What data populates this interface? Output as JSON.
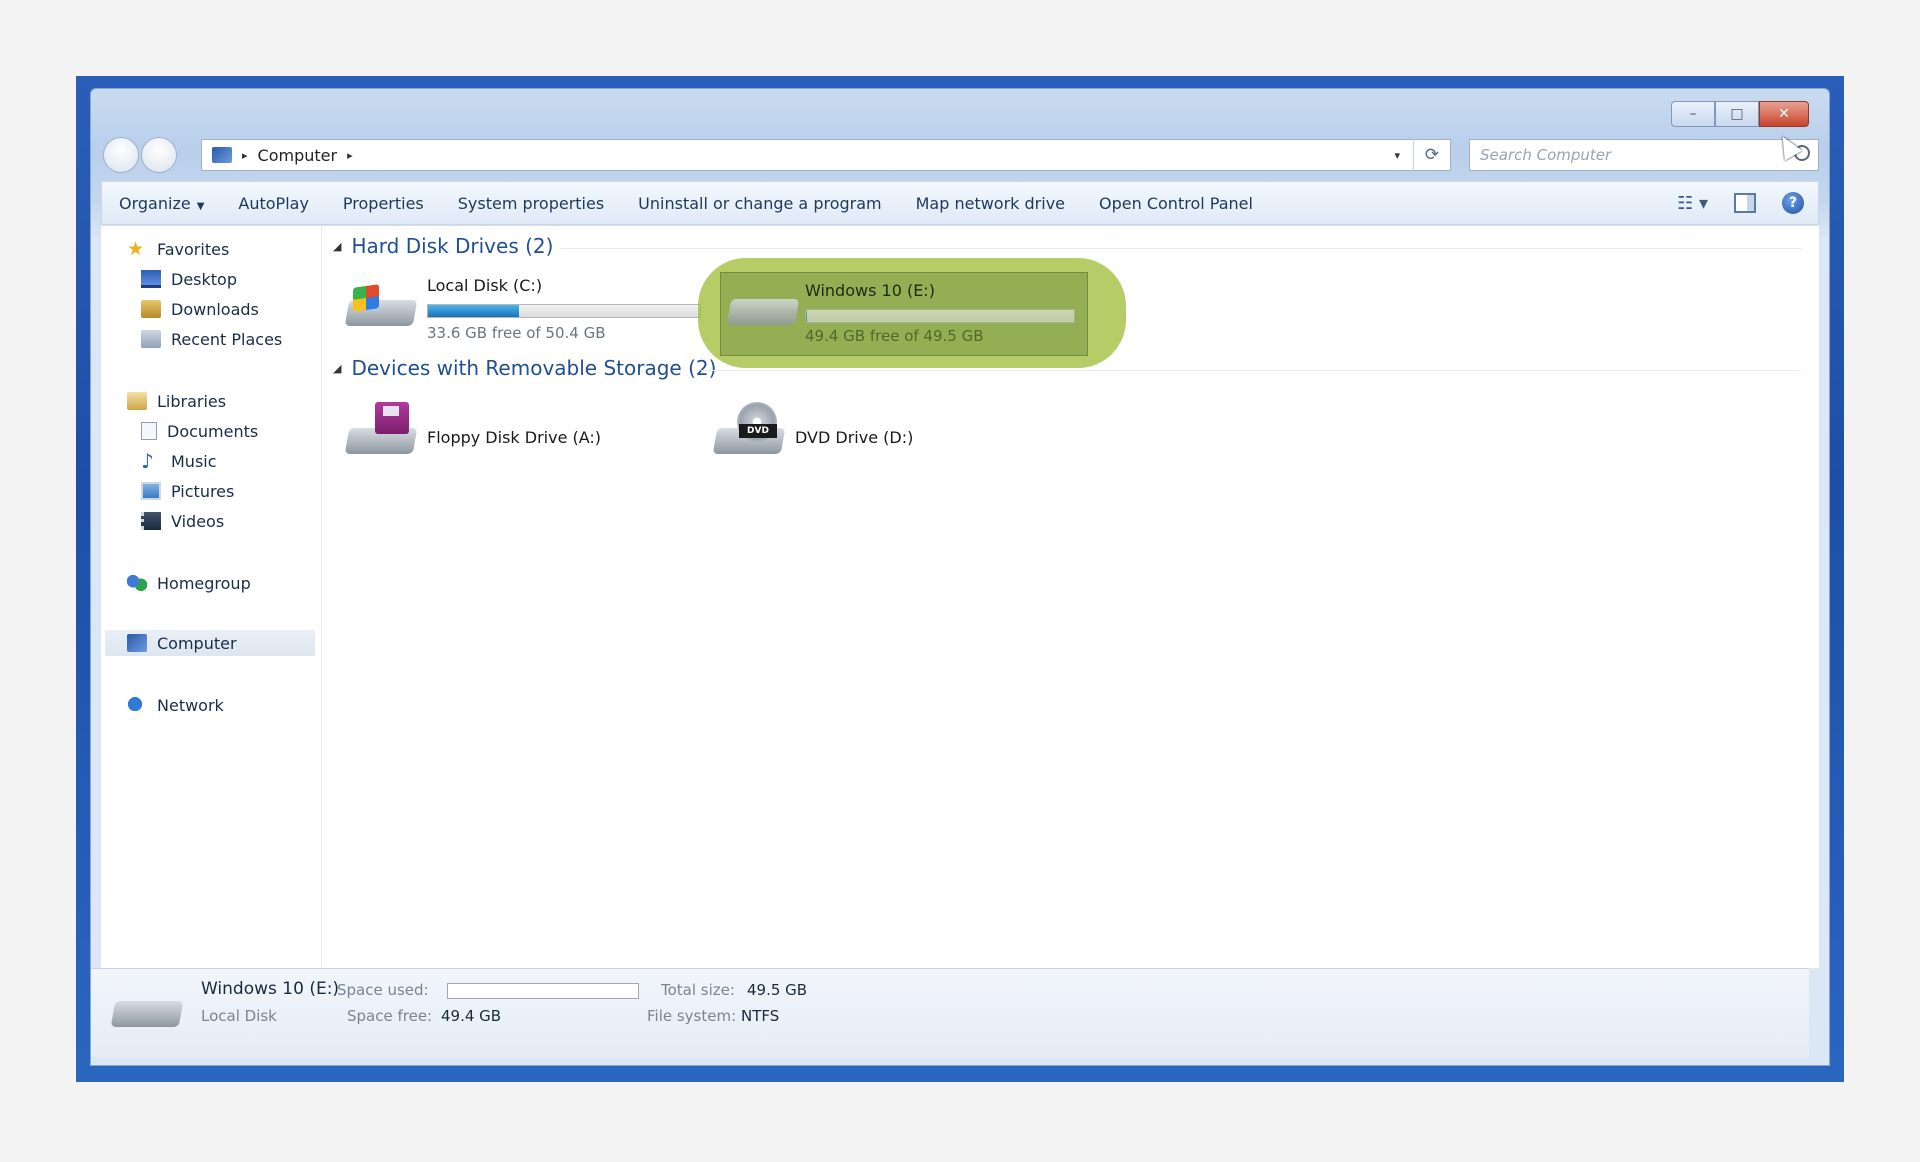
{
  "window": {
    "title_buttons": {
      "minimize": "–",
      "maximize": "□",
      "close": "✕"
    }
  },
  "address_bar": {
    "location": "Computer",
    "separator": "▸",
    "dropdown": "▾",
    "refresh": "⟳"
  },
  "search": {
    "placeholder": "Search Computer"
  },
  "command_bar": {
    "organize": "Organize",
    "autoplay": "AutoPlay",
    "properties": "Properties",
    "system_properties": "System properties",
    "uninstall": "Uninstall or change a program",
    "map_drive": "Map network drive",
    "control_panel": "Open Control Panel",
    "help": "?"
  },
  "sidebar": {
    "favorites": "Favorites",
    "desktop": "Desktop",
    "downloads": "Downloads",
    "recent_places": "Recent Places",
    "libraries": "Libraries",
    "documents": "Documents",
    "music": "Music",
    "pictures": "Pictures",
    "videos": "Videos",
    "homegroup": "Homegroup",
    "computer": "Computer",
    "network": "Network"
  },
  "groups": {
    "hard_disks": "Hard Disk Drives (2)",
    "removable": "Devices with Removable Storage (2)"
  },
  "drives": {
    "c": {
      "name": "Local Disk (C:)",
      "free_text": "33.6 GB free of 50.4 GB",
      "used_fraction": 0.333
    },
    "e": {
      "name": "Windows 10 (E:)",
      "free_text": "49.4 GB free of 49.5 GB",
      "used_fraction": 0.002
    },
    "a": {
      "name": "Floppy Disk Drive (A:)"
    },
    "d": {
      "name": "DVD Drive (D:)",
      "label": "DVD"
    }
  },
  "details": {
    "name": "Windows 10 (E:)",
    "type": "Local Disk",
    "space_used_label": "Space used:",
    "space_free_label": "Space free:",
    "space_free_value": "49.4 GB",
    "total_size_label": "Total size:",
    "total_size_value": "49.5 GB",
    "file_system_label": "File system:",
    "file_system_value": "NTFS"
  },
  "colors": {
    "highlight": "#a0be3c",
    "accent": "#1f4f94"
  }
}
